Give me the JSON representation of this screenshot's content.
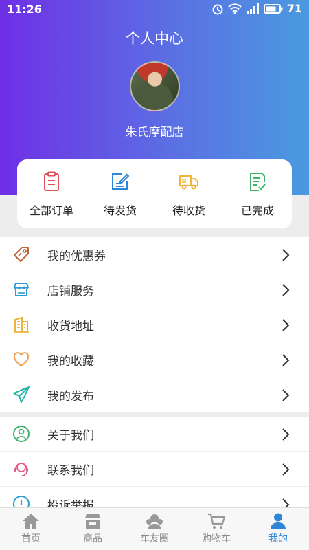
{
  "status_bar": {
    "time": "11:26",
    "battery": "71"
  },
  "header": {
    "title": "个人中心",
    "store_name": "朱氏摩配店"
  },
  "orders": [
    {
      "label": "全部订单",
      "icon": "clipboard-icon",
      "color": "#e0505a"
    },
    {
      "label": "待发货",
      "icon": "edit-icon",
      "color": "#2f86d6"
    },
    {
      "label": "待收货",
      "icon": "truck-icon",
      "color": "#f0b43a"
    },
    {
      "label": "已完成",
      "icon": "check-doc-icon",
      "color": "#3fb36b"
    }
  ],
  "menu_group_1": [
    {
      "label": "我的优惠券",
      "icon": "coupon-tag-icon",
      "color": "#c0653a"
    },
    {
      "label": "店铺服务",
      "icon": "store-icon",
      "color": "#2f9bd6"
    },
    {
      "label": "收货地址",
      "icon": "building-icon",
      "color": "#f0b43a"
    },
    {
      "label": "我的收藏",
      "icon": "heart-icon",
      "color": "#f0a050"
    },
    {
      "label": "我的发布",
      "icon": "send-icon",
      "color": "#1fb5a6"
    }
  ],
  "menu_group_2": [
    {
      "label": "关于我们",
      "icon": "user-circle-icon",
      "color": "#3fb36b"
    },
    {
      "label": "联系我们",
      "icon": "headset-icon",
      "color": "#e05a8a"
    },
    {
      "label": "投诉举报",
      "icon": "info-icon",
      "color": "#2f9bd6"
    }
  ],
  "tabs": [
    {
      "label": "首页",
      "icon": "home-icon",
      "active": false
    },
    {
      "label": "商品",
      "icon": "shop-icon",
      "active": false
    },
    {
      "label": "车友圈",
      "icon": "community-icon",
      "active": false
    },
    {
      "label": "购物车",
      "icon": "cart-icon",
      "active": false
    },
    {
      "label": "我的",
      "icon": "person-icon",
      "active": true
    }
  ]
}
